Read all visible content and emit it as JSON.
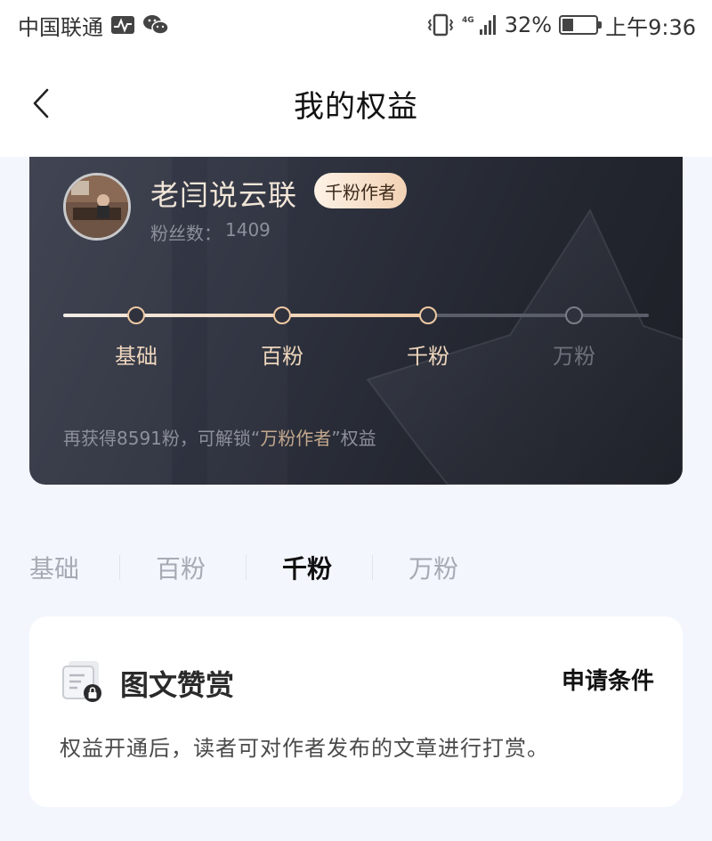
{
  "status_bar": {
    "carrier": "中国联通",
    "activity_icon": "activity-monitor-icon",
    "chat_icon": "wechat-icon",
    "vibrate_icon": "vibrate-icon",
    "network": "4G",
    "signal_icon": "signal-icon",
    "battery_percent": "32%",
    "battery_level": 0.32,
    "time": "上午9:36"
  },
  "nav": {
    "title": "我的权益",
    "back_icon": "chevron-left-icon"
  },
  "profile": {
    "name": "老闫说云联",
    "badge": "千粉作者",
    "fans_label": "粉丝数：",
    "fans_count": "1409"
  },
  "levels": {
    "current_index": 2,
    "items": [
      "基础",
      "百粉",
      "千粉",
      "万粉"
    ]
  },
  "unlock_hint": {
    "prefix": "再获得8591粉，可解锁“",
    "highlight": "万粉作者",
    "suffix": "”权益"
  },
  "tabs": {
    "active_index": 2,
    "items": [
      "基础",
      "百粉",
      "千粉",
      "万粉"
    ]
  },
  "benefit": {
    "icon": "image-text-reward-locked-icon",
    "title": "图文赞赏",
    "apply_label": "申请条件",
    "description": "权益开通后，读者可对作者发布的文章进行打赏。"
  },
  "colors": {
    "accent_gold": "#efc9a3",
    "card_dark": "#2f3340",
    "page_bg": "#f3f7fd"
  }
}
